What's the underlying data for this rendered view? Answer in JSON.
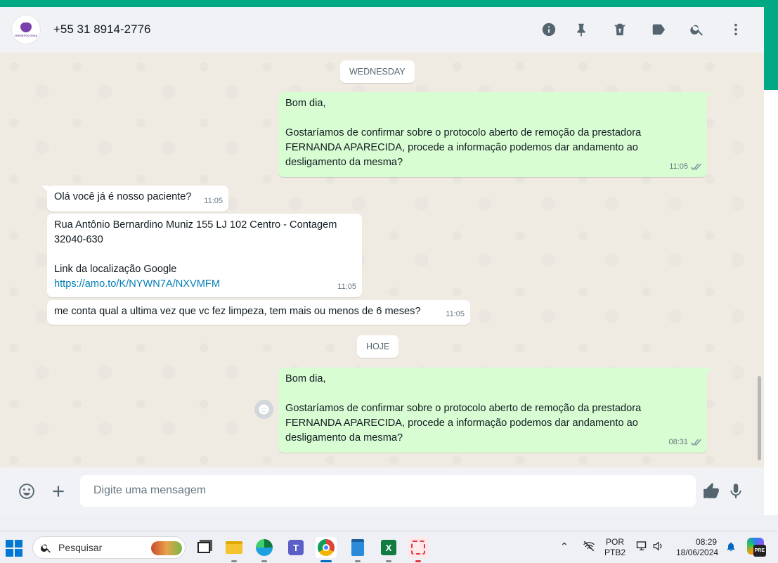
{
  "header": {
    "contact_name": "+55 31 8914-2776",
    "avatar_text": "ODONTOLOGIA",
    "icons": [
      "info-icon",
      "pin-icon",
      "delete-icon",
      "label-icon",
      "search-icon",
      "menu-icon"
    ]
  },
  "chat": {
    "day_chips": [
      "WEDNESDAY",
      "HOJE"
    ],
    "messages": [
      {
        "dir": "out",
        "text": "Bom dia,\n\nGostaríamos de confirmar sobre o protocolo aberto de remoção da prestadora\nFERNANDA APARECIDA, procede a informação podemos dar andamento ao\ndesligamento da mesma?",
        "time": "11:05",
        "status": "read"
      },
      {
        "dir": "in",
        "text": "Olá você já é nosso paciente?",
        "time": "11:05"
      },
      {
        "dir": "in",
        "text": "Rua Antônio Bernardino Muniz 155 LJ 102 Centro - Contagem\n32040-630\n\nLink da localização Google",
        "link": "https://amo.to/K/NYWN7A/NXVMFM",
        "time": "11:05"
      },
      {
        "dir": "in",
        "text": "me conta qual a ultima vez que vc fez limpeza, tem mais ou menos de 6 meses?",
        "time": "11:05"
      },
      {
        "dir": "out",
        "text": "Bom dia,\n\nGostaríamos de confirmar sobre o protocolo aberto de remoção da prestadora\nFERNANDA APARECIDA, procede a informação podemos dar andamento ao\ndesligamento da mesma?",
        "time": "08:31",
        "status": "read"
      }
    ]
  },
  "footer": {
    "placeholder": "Digite uma mensagem"
  },
  "taskbar": {
    "search_label": "Pesquisar",
    "lang_top": "POR",
    "lang_bottom": "PTB2",
    "clock_time": "08:29",
    "clock_date": "18/06/2024",
    "copilot_badge": "PRE"
  }
}
